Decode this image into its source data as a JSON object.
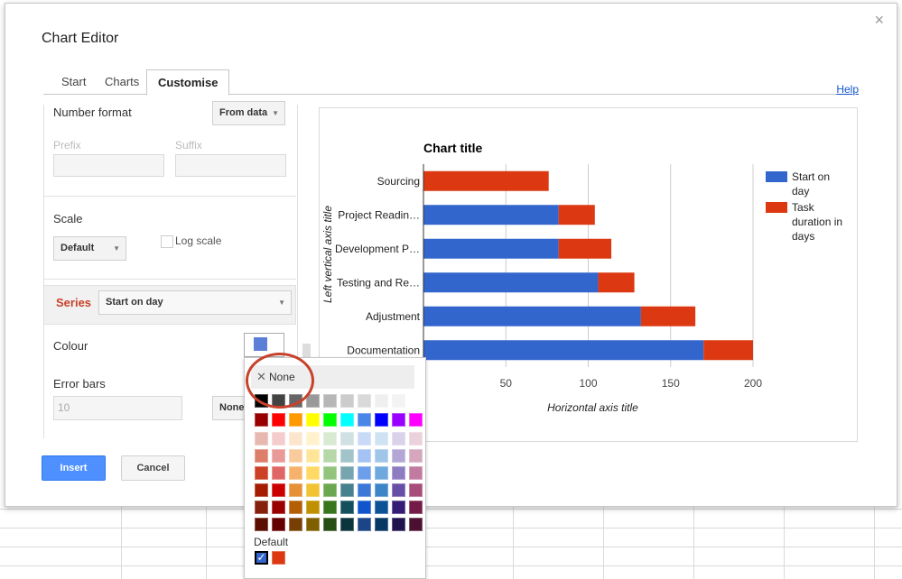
{
  "dialog": {
    "title": "Chart Editor",
    "close_label": "×",
    "help_label": "Help"
  },
  "tabs": [
    {
      "label": "Start",
      "active": false
    },
    {
      "label": "Charts",
      "active": false
    },
    {
      "label": "Customise",
      "active": true
    }
  ],
  "panel": {
    "number_format_label": "Number format",
    "number_format_value": "From data",
    "prefix_label": "Prefix",
    "suffix_label": "Suffix",
    "scale_label": "Scale",
    "scale_value": "Default",
    "log_scale_label": "Log scale",
    "series_label": "Series",
    "series_value": "Start on day",
    "colour_label": "Colour",
    "error_bars_label": "Error bars",
    "error_value": "10",
    "error_type": "None"
  },
  "buttons": {
    "insert_label": "Insert",
    "cancel_label": "Cancel"
  },
  "colour_picker": {
    "none_label": "None",
    "default_label": "Default",
    "greys": [
      "#000000",
      "#434343",
      "#666666",
      "#999999",
      "#b7b7b7",
      "#cccccc",
      "#d9d9d9",
      "#efefef",
      "#f3f3f3",
      "#ffffff"
    ],
    "brights": [
      "#980000",
      "#ff0000",
      "#ff9900",
      "#ffff00",
      "#00ff00",
      "#00ffff",
      "#4a86e8",
      "#0000ff",
      "#9900ff",
      "#ff00ff"
    ],
    "shades": [
      [
        "#e6b8af",
        "#f4cccc",
        "#fce5cd",
        "#fff2cc",
        "#d9ead3",
        "#d0e0e3",
        "#c9daf8",
        "#cfe2f3",
        "#d9d2e9",
        "#ead1dc"
      ],
      [
        "#dd7e6b",
        "#ea9999",
        "#f9cb9c",
        "#ffe599",
        "#b6d7a8",
        "#a2c4c9",
        "#a4c2f4",
        "#9fc5e8",
        "#b4a7d6",
        "#d5a6bd"
      ],
      [
        "#cc4125",
        "#e06666",
        "#f6b26b",
        "#ffd966",
        "#93c47d",
        "#76a5af",
        "#6d9eeb",
        "#6fa8dc",
        "#8e7cc3",
        "#c27ba0"
      ],
      [
        "#a61c00",
        "#cc0000",
        "#e69138",
        "#f1c232",
        "#6aa84f",
        "#45818e",
        "#3c78d8",
        "#3d85c6",
        "#674ea7",
        "#a64d79"
      ],
      [
        "#85200c",
        "#990000",
        "#b45f06",
        "#bf9000",
        "#38761d",
        "#134f5c",
        "#1155cc",
        "#0b5394",
        "#351c75",
        "#741b47"
      ],
      [
        "#5b0f00",
        "#660000",
        "#783f04",
        "#7f6000",
        "#274e13",
        "#0c343d",
        "#1c4587",
        "#073763",
        "#20124d",
        "#4c1130"
      ]
    ],
    "default_colors": [
      "#3366cc",
      "#dc3912"
    ]
  },
  "chart_data": {
    "type": "bar",
    "title": "Chart title",
    "xlabel": "Horizontal axis title",
    "ylabel": "Left vertical axis title",
    "categories": [
      "Sourcing",
      "Project Readin…",
      "Development P…",
      "Testing and Re…",
      "Adjustment",
      "Documentation"
    ],
    "series": [
      {
        "name": "Start on day",
        "values": [
          0,
          82,
          82,
          106,
          132,
          170
        ],
        "color": "#3366cc"
      },
      {
        "name": "Task duration in days",
        "values": [
          76,
          22,
          32,
          22,
          33,
          30
        ],
        "color": "#dc3912"
      }
    ],
    "stacked": true,
    "xlim": [
      0,
      200
    ],
    "xticks": [
      "50",
      "100",
      "150",
      "200"
    ],
    "legend_position": "right",
    "legend_labels": [
      [
        "Start on",
        "day"
      ],
      [
        "Task",
        "duration in",
        "days"
      ]
    ]
  }
}
